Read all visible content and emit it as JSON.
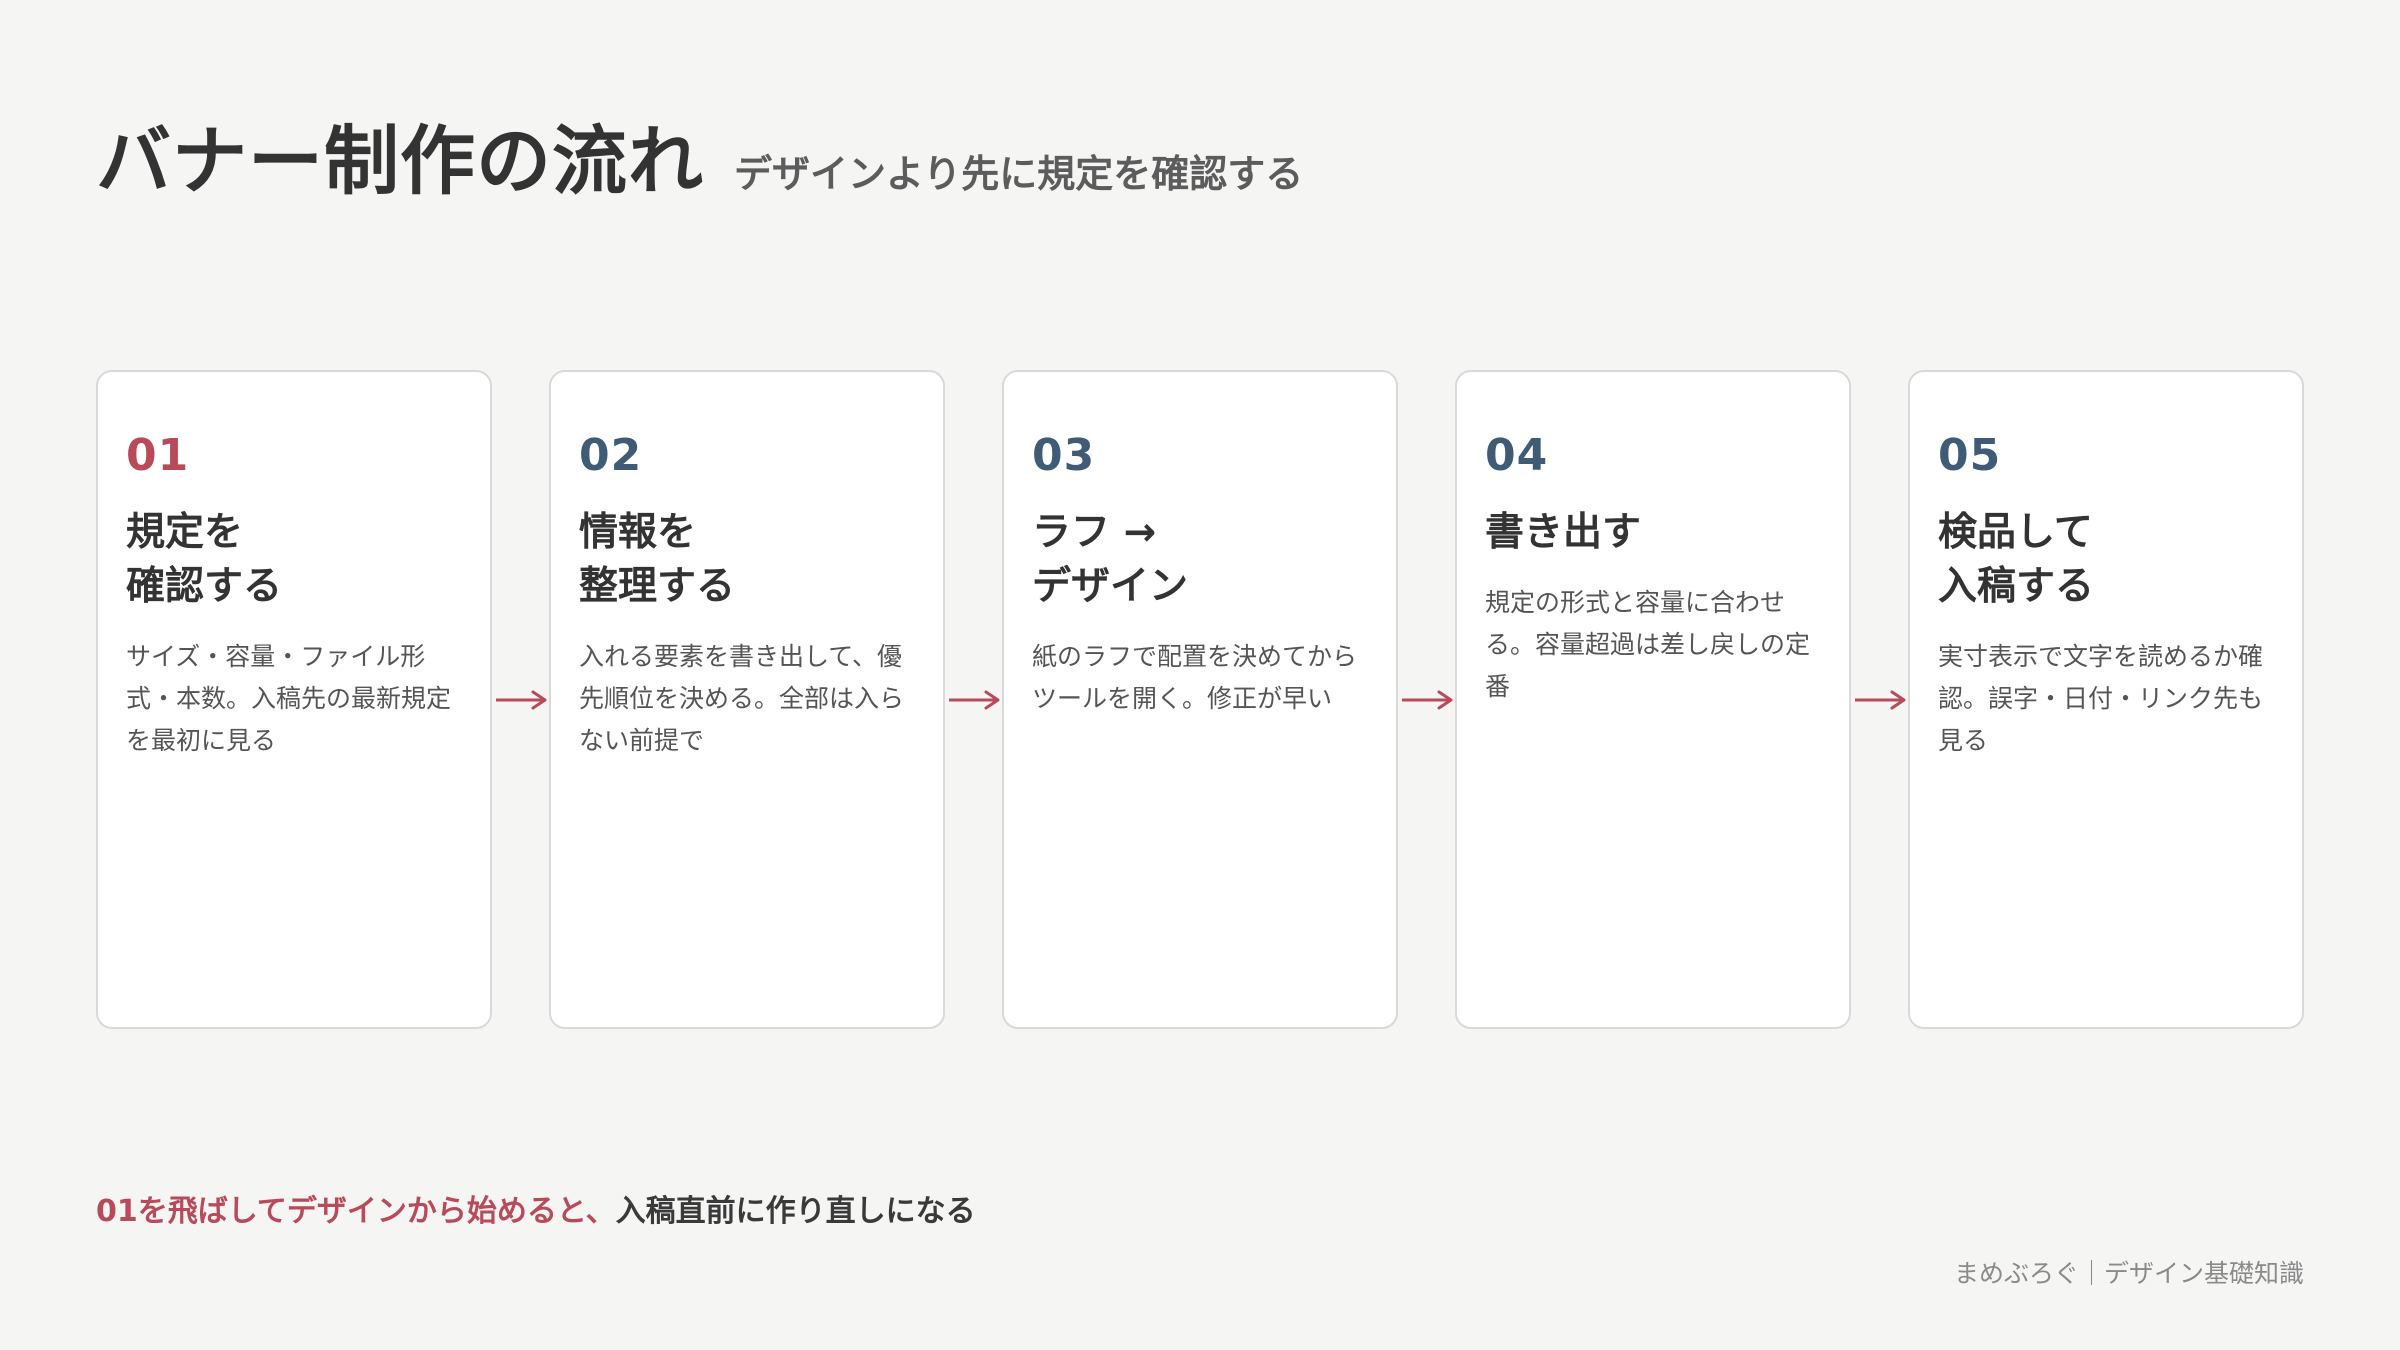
{
  "header": {
    "title": "バナー制作の流れ",
    "subtitle": "デザインより先に規定を確認する"
  },
  "steps": [
    {
      "number": "01",
      "title": "規定を\n確認する",
      "description": "サイズ・容量・ファイル形式・本数。入稿先の最新規定を最初に見る"
    },
    {
      "number": "02",
      "title": "情報を\n整理する",
      "description": "入れる要素を書き出して、優先順位を決める。全部は入らない前提で"
    },
    {
      "number": "03",
      "title": "ラフ →\nデザイン",
      "description": "紙のラフで配置を決めてからツールを開く。修正が早い"
    },
    {
      "number": "04",
      "title": "書き出す",
      "description": "規定の形式と容量に合わせる。容量超過は差し戻しの定番"
    },
    {
      "number": "05",
      "title": "検品して\n入稿する",
      "description": "実寸表示で文字を読めるか確認。誤字・日付・リンク先も見る"
    }
  ],
  "note": {
    "accent": "01を飛ばしてデザインから始めると、",
    "rest": "入稿直前に作り直しになる"
  },
  "footer": {
    "text": "まめぶろぐ｜デザイン基礎知識"
  },
  "colors": {
    "accent": "#b84a5a",
    "number": "#3f5b75",
    "background": "#f5f5f4",
    "card": "#ffffff",
    "border": "#d9d9d9"
  },
  "icons": {
    "connector": "arrow-right-icon"
  }
}
